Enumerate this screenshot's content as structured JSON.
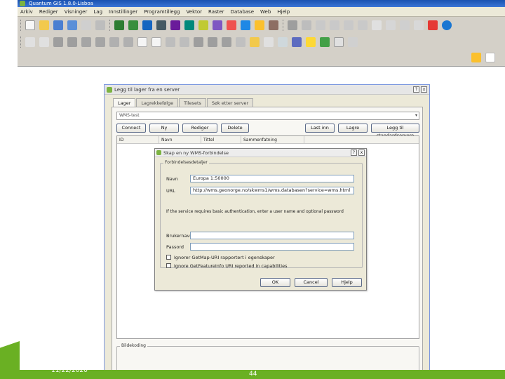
{
  "qgis": {
    "title": "Quantum GIS 1.8.0-Lisboa",
    "menu": [
      "Arkiv",
      "Rediger",
      "Visninger",
      "Lag",
      "Innstillinger",
      "Programtillegg",
      "Vektor",
      "Raster",
      "Database",
      "Web",
      "Hjelp"
    ]
  },
  "layer_dialog": {
    "title": "Legg til lager fra en server",
    "help_glyph": "?",
    "close_glyph": "x",
    "tabs": [
      "Lager",
      "Lagrekkefølge",
      "Tilesets",
      "Søk etter server"
    ],
    "server_selected": "WMS-test",
    "buttons": {
      "connect": "Connect",
      "new": "Ny",
      "edit": "Rediger",
      "delete": "Delete",
      "load": "Last inn",
      "save": "Lagre",
      "add_default": "Legg til standardservere"
    },
    "columns": [
      "ID",
      "Navn",
      "Tittel",
      "Sammenfatning"
    ],
    "encoding_legend": "Bildekoding"
  },
  "wms_dialog": {
    "title": "Skap en ny WMS-forbindelse",
    "help_glyph": "?",
    "close_glyph": "x",
    "group_legend": "Forbindelsesdetaljer",
    "name_label": "Navn",
    "name_value": "Europa 1:50000",
    "url_label": "URL",
    "url_value": "http://wms.geonorge.no/skwms1/wms.databasen?service=wms.html",
    "auth_note": "If the service requires basic authentication, enter a user name and optional password",
    "user_label": "Brukernavn",
    "password_label": "Passord",
    "ignore_getmap": "Ignorer GetMap-URI rapportert i egenskaper",
    "ignore_getfeature": "Ignore GetFeatureInfo URI reported in capabilities",
    "ok": "OK",
    "cancel": "Cancel",
    "help": "Hjelp"
  },
  "footer": {
    "date": "11/22/2020",
    "page": "44"
  },
  "colors": {
    "slide_green": "#6ab023",
    "titlebar_blue": "#1a52b0",
    "dialog_bg": "#ece9d8"
  }
}
